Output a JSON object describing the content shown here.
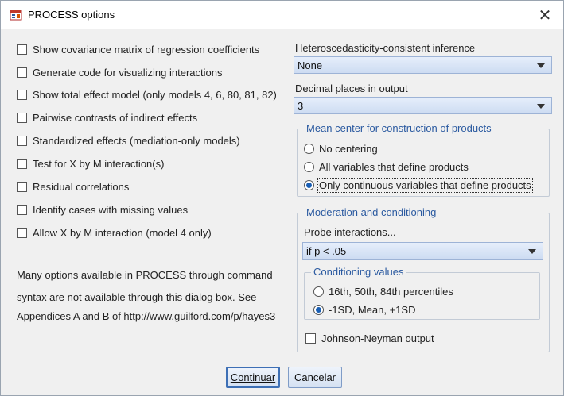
{
  "window": {
    "title": "PROCESS options",
    "close_glyph": "✕",
    "icon": "spss-dialog-icon"
  },
  "left_options": [
    {
      "label": "Show covariance matrix of regression coefficients",
      "checked": false
    },
    {
      "label": "Generate code for visualizing interactions",
      "checked": false
    },
    {
      "label": "Show total effect model (only models 4, 6, 80, 81, 82)",
      "checked": false
    },
    {
      "label": "Pairwise contrasts of indirect effects",
      "checked": false
    },
    {
      "label": "Standardized effects (mediation-only models)",
      "checked": false
    },
    {
      "label": "Test for X by M interaction(s)",
      "checked": false
    },
    {
      "label": "Residual correlations",
      "checked": false
    },
    {
      "label": "Identify cases with missing values",
      "checked": false
    },
    {
      "label": "Allow X by M interaction (model 4 only)",
      "checked": false
    }
  ],
  "note": {
    "line1": "Many options available in PROCESS through command",
    "line2": "syntax are not available through this dialog box.  See",
    "line3": "Appendices A and B of http://www.guilford.com/p/hayes3"
  },
  "hc_inference": {
    "label": "Heteroscedasticity-consistent inference",
    "value": "None"
  },
  "decimal_places": {
    "label": "Decimal places in output",
    "value": "3"
  },
  "mean_center": {
    "legend": "Mean center for construction of products",
    "options": [
      {
        "label": "No centering",
        "selected": false
      },
      {
        "label": "All variables that define products",
        "selected": false
      },
      {
        "label": "Only continuous variables that define products",
        "selected": true
      }
    ]
  },
  "moderation": {
    "legend": "Moderation and conditioning",
    "probe_label": "Probe interactions...",
    "probe_value": "if p <  .05",
    "conditioning": {
      "legend": "Conditioning values",
      "options": [
        {
          "label": "16th, 50th, 84th percentiles",
          "selected": false
        },
        {
          "label": "-1SD, Mean, +1SD",
          "selected": true
        }
      ]
    },
    "johnson_neyman": {
      "label": "Johnson-Neyman output",
      "checked": false
    }
  },
  "buttons": {
    "continue": "Continuar",
    "cancel": "Cancelar"
  },
  "colors": {
    "accent": "#2b5aa0",
    "radio_dot": "#1a5fb4"
  }
}
